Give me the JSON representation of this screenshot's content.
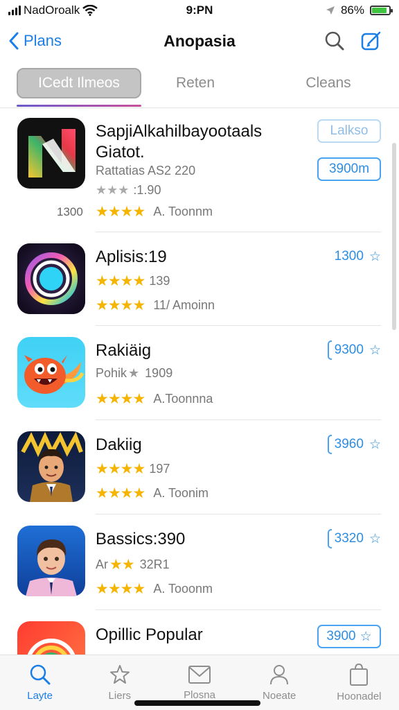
{
  "status_bar": {
    "carrier": "NadOroalk",
    "time": "9:PN",
    "battery": "86%",
    "battery_level": 0.86
  },
  "nav": {
    "back_label": "Plans",
    "title": "Anopasia"
  },
  "tabs": [
    {
      "label": "ICedt Ilmeos"
    },
    {
      "label": "Reten"
    },
    {
      "label": "Cleans"
    }
  ],
  "apps": [
    {
      "title_line1": "SapjiAlkahilbayootaals",
      "title_line2": "Giatot.",
      "meta1": "Rattatias AS2 220",
      "meta2_stars": "★★★",
      "meta2_text": ":1.90",
      "left_num": "1300",
      "stars": "★★★★",
      "meta3": "A. Toonnm",
      "action_top": "Lalkso",
      "action": "3900m"
    },
    {
      "title_line1": "Aplisis:19",
      "meta1_stars": "★★★★",
      "meta1_text": "139",
      "stars": "★★★★",
      "meta3": "11/ Amoinn",
      "action": "1300"
    },
    {
      "title_line1": "Rakiäig",
      "meta1_prefix": "Pohik",
      "meta1_stars": "★",
      "meta1_text": "1909",
      "stars": "★★★★",
      "meta3": "A.Toonnna",
      "action": "9300"
    },
    {
      "title_line1": "Dakiig",
      "meta1_stars": "★★★★",
      "meta1_text": "197",
      "stars": "★★★★",
      "meta3": "A. Toonim",
      "action": "3960"
    },
    {
      "title_line1": "Bassics:390",
      "meta1_prefix": "Ar",
      "meta1_stars": "★★",
      "meta1_text": "32R1",
      "stars": "★★★★",
      "meta3": "A. Tooonm",
      "action": "3320"
    },
    {
      "title_line1": "Opillic Popular",
      "action": "3900"
    }
  ],
  "tab_bar": [
    {
      "label": "Layte",
      "icon": "search-icon"
    },
    {
      "label": "Liers",
      "icon": "star-outline-icon"
    },
    {
      "label": "Plosna",
      "icon": "mail-icon"
    },
    {
      "label": "Noeate",
      "icon": "person-icon"
    },
    {
      "label": "Hoonadel",
      "icon": "bag-icon"
    }
  ],
  "colors": {
    "accent": "#1a7ee6",
    "star": "#f4b400"
  }
}
